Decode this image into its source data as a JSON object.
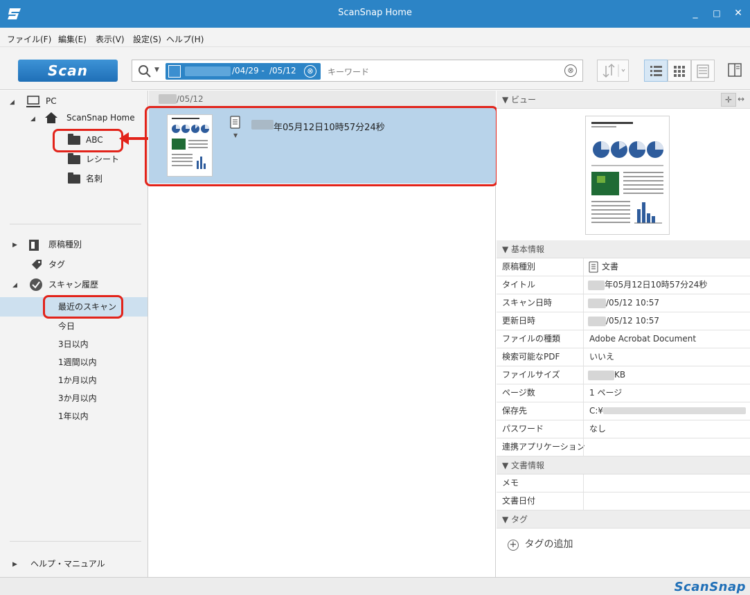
{
  "window": {
    "title": "ScanSnap Home",
    "minimize": "_",
    "maximize": "□",
    "close": "✕"
  },
  "menu": [
    "ファイル(F)",
    "編集(E)",
    "表示(V)",
    "設定(S)",
    "ヘルプ(H)"
  ],
  "toolbar": {
    "scan_label": "Scan",
    "date_start": "/04/29 -",
    "date_end": "/05/12",
    "keyword_placeholder": "キーワード",
    "clear_glyph": "⊗"
  },
  "nav": {
    "pc": "PC",
    "home": "ScanSnap Home",
    "folders": [
      "ABC",
      "レシート",
      "名刺"
    ],
    "doc_type": "原稿種別",
    "tag": "タグ",
    "history": "スキャン履歴",
    "history_items": [
      "最近のスキャン",
      "今日",
      "3日以内",
      "1週間以内",
      "1か月以内",
      "3か月以内",
      "1年以内"
    ],
    "help": "ヘルプ・マニュアル"
  },
  "list": {
    "group_date": "/05/12",
    "item_title": "年05月12日10時57分24秒"
  },
  "details": {
    "view_header": "ビュー",
    "basic_header": "基本情報",
    "properties": [
      {
        "label": "原稿種別",
        "value": "文書"
      },
      {
        "label": "タイトル",
        "value": "年05月12日10時57分24秒"
      },
      {
        "label": "スキャン日時",
        "value": "/05/12 10:57"
      },
      {
        "label": "更新日時",
        "value": "/05/12 10:57"
      },
      {
        "label": "ファイルの種類",
        "value": "Adobe Acrobat Document"
      },
      {
        "label": "検索可能なPDF",
        "value": "いいえ"
      },
      {
        "label": "ファイルサイズ",
        "value": "KB"
      },
      {
        "label": "ページ数",
        "value": "1 ページ"
      },
      {
        "label": "保存先",
        "value": "C:¥"
      },
      {
        "label": "パスワード",
        "value": "なし"
      },
      {
        "label": "連携アプリケーション",
        "value": ""
      }
    ],
    "doc_header": "文書情報",
    "doc_properties": [
      {
        "label": "メモ",
        "value": ""
      },
      {
        "label": "文書日付",
        "value": ""
      }
    ],
    "tag_header": "タグ",
    "add_tag": "タグの追加"
  },
  "status": {
    "brand": "ScanSnap"
  },
  "colors": {
    "accent": "#2c84c6",
    "selection": "#b8d3ea",
    "highlight": "#e2231a"
  }
}
